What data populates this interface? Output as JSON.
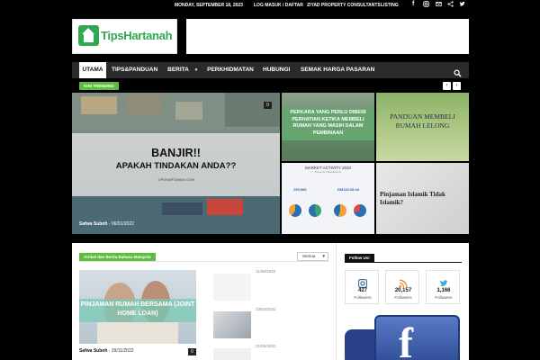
{
  "topbar": {
    "date": "MONDAY, SEPTEMBER 18, 2023",
    "login": "LOG MASUK / DAFTAR",
    "partner": "ZIYAD PROPERTY CONSULTANTS",
    "listing": "LISTING",
    "icons": [
      "facebook-icon",
      "instagram-icon",
      "email-icon",
      "share-icon",
      "twitter-icon"
    ]
  },
  "header": {
    "logo_text": "TipsHartanah"
  },
  "nav": {
    "items": [
      "UTAMA",
      "TIPS&PANDUAN",
      "BERITA",
      "PERKHIDMATAN",
      "HUBUNGI",
      "SEMAK HARGA PASARAN"
    ],
    "active": "UTAMA"
  },
  "trending": {
    "label": "KINI TRENDING"
  },
  "hero": {
    "line1": "BANJIR!!",
    "line2": "APAKAH TINDAKAN ANDA??",
    "site": "TIPSHARTANAH.COM",
    "author": "Safwa Suboh",
    "date": "06/01/2022",
    "comments": "0"
  },
  "tiles": {
    "t1_text": "PERKARA YANG PERLU DIBERI PERHATIAN KETIKA MEMBELI RUMAH YANG MASIH DALAM PEMBINAAN",
    "t2_text": "PANDUAN MEMBELI RUMAH LELONG",
    "t3_title": "MARKET ACTIVITY 2020",
    "t3_sub": "Property Transactions",
    "t3_left": "295,968",
    "t3_right": "RM119.08 bil",
    "t4_text": "Pinjaman Islamik Tidak Islamik?"
  },
  "section": {
    "badge": "Artikel dan Berita Bahasa Malaysia",
    "filter": "Semua",
    "main_title": "PINJAMAN RUMAH BERSAMA (JOINT HOME LOAN)",
    "main_author": "Safwa Suboh",
    "main_date": "29/11/2022",
    "main_comments": "0",
    "side_dates": [
      "11/08/2022",
      "23/03/2022",
      "21/03/2022"
    ]
  },
  "follow": {
    "title": "Follow Us!",
    "cards": [
      {
        "count": "427",
        "label": "Followers",
        "icon": "instagram-icon"
      },
      {
        "count": "20,157",
        "label": "Followers",
        "icon": "rss-icon"
      },
      {
        "count": "1,166",
        "label": "Followers",
        "icon": "twitter-icon"
      }
    ]
  },
  "colors": {
    "accent": "#5ebd3e",
    "logo_green": "#2fa84f",
    "nav_bg": "#2a2a2a"
  }
}
